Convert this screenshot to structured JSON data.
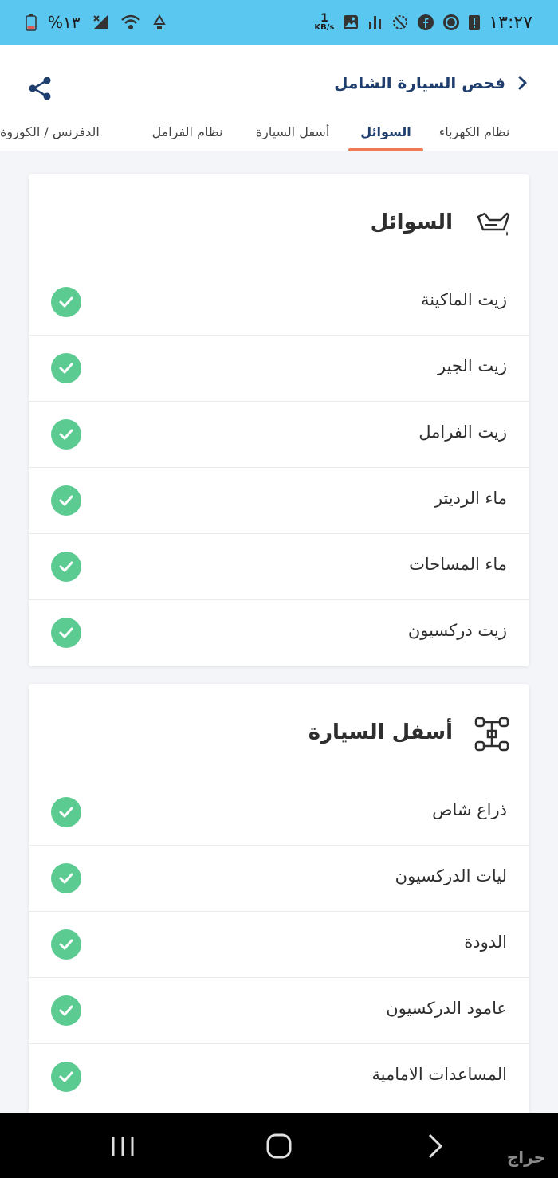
{
  "status_bar": {
    "time": "١٣:٢٧",
    "battery": "%١٣",
    "net_speed_value": "1",
    "net_speed_unit": "KB/s"
  },
  "header": {
    "title": "فحص السيارة الشامل",
    "back_icon": "chevron-right-icon",
    "share_icon": "share-icon"
  },
  "tabs": [
    {
      "label": "نظام الكهرباء",
      "active": false
    },
    {
      "label": "السوائل",
      "active": true
    },
    {
      "label": "أسفل السيارة",
      "active": false
    },
    {
      "label": "نظام الفرامل",
      "active": false
    },
    {
      "label": "الدفرنس / الكوروة",
      "active": false
    }
  ],
  "sections": [
    {
      "title": "السوائل",
      "icon": "oil-can-icon",
      "items": [
        {
          "label": "زيت الماكينة",
          "status": "pass"
        },
        {
          "label": "زيت الجير",
          "status": "pass"
        },
        {
          "label": "زيت الفرامل",
          "status": "pass"
        },
        {
          "label": "ماء الرديتر",
          "status": "pass"
        },
        {
          "label": "ماء المساحات",
          "status": "pass"
        },
        {
          "label": "زيت دركسيون",
          "status": "pass"
        }
      ]
    },
    {
      "title": "أسفل السيارة",
      "icon": "chassis-icon",
      "items": [
        {
          "label": "ذراع شاص",
          "status": "pass"
        },
        {
          "label": "ليات الدركسيون",
          "status": "pass"
        },
        {
          "label": "الدودة",
          "status": "pass"
        },
        {
          "label": "عامود الدركسيون",
          "status": "pass"
        },
        {
          "label": "المساعدات الامامية",
          "status": "pass"
        }
      ]
    }
  ],
  "colors": {
    "status_bar": "#5ac7f0",
    "title": "#1f3e6e",
    "active_tab_underline": "#ef7a55",
    "check": "#5ccb92"
  },
  "watermark": "حراج"
}
